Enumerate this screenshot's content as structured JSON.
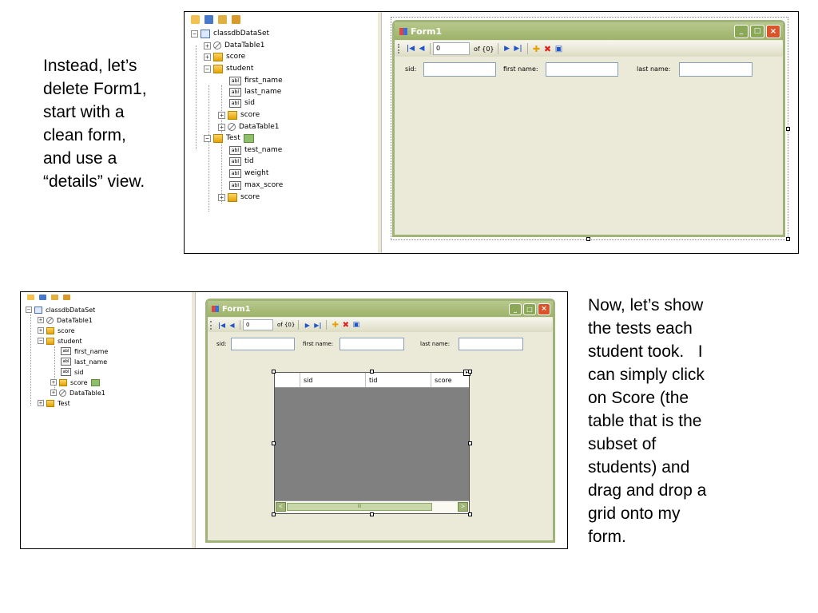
{
  "captions": {
    "top": [
      "Instead, let’s",
      "delete Form1,",
      "start with a",
      "clean form,",
      "and use a",
      "“details” view."
    ],
    "bottom": [
      "Now, let’s show",
      "the tests each",
      "student took.   I",
      "can simply click",
      "on Score (the",
      "table that is the",
      "subset of",
      "students) and",
      "drag and drop a",
      "grid onto my",
      "form."
    ]
  },
  "top_shot": {
    "tree": {
      "root": "classdbDataSet",
      "nodes": {
        "datatable1": "DataTable1",
        "score": "score",
        "student": "student",
        "first_name": "first_name",
        "last_name": "last_name",
        "sid": "sid",
        "student_score": "score",
        "student_datatable1": "DataTable1",
        "test": "Test",
        "test_name": "test_name",
        "tid": "tid",
        "weight": "weight",
        "max_score": "max_score",
        "test_score": "score"
      },
      "abl": "abl"
    },
    "form": {
      "title": "Form1",
      "nav": {
        "position": "0",
        "of_count": "of {0}"
      },
      "fields": {
        "sid": "sid:",
        "first_name": "first name:",
        "last_name": "last name:"
      }
    }
  },
  "bottom_shot": {
    "tree": {
      "root": "classdbDataSet",
      "nodes": {
        "datatable1": "DataTable1",
        "score": "score",
        "student": "student",
        "first_name": "first_name",
        "last_name": "last_name",
        "sid": "sid",
        "student_score": "score",
        "student_datatable1": "DataTable1",
        "test": "Test"
      },
      "abl": "abl"
    },
    "form": {
      "title": "Form1",
      "nav": {
        "position": "0",
        "of_count": "of {0}"
      },
      "fields": {
        "sid": "sid:",
        "first_name": "first name:",
        "last_name": "last name:"
      },
      "grid": {
        "columns": [
          "sid",
          "tid",
          "score"
        ],
        "scroll_thumb": "III"
      }
    }
  },
  "colors": {
    "title_bar": "#9db26a",
    "form_bg": "#ebe9d7",
    "close_btn": "#d9542b",
    "nav_icon": "#2255cc",
    "grid_bg": "#808080"
  }
}
